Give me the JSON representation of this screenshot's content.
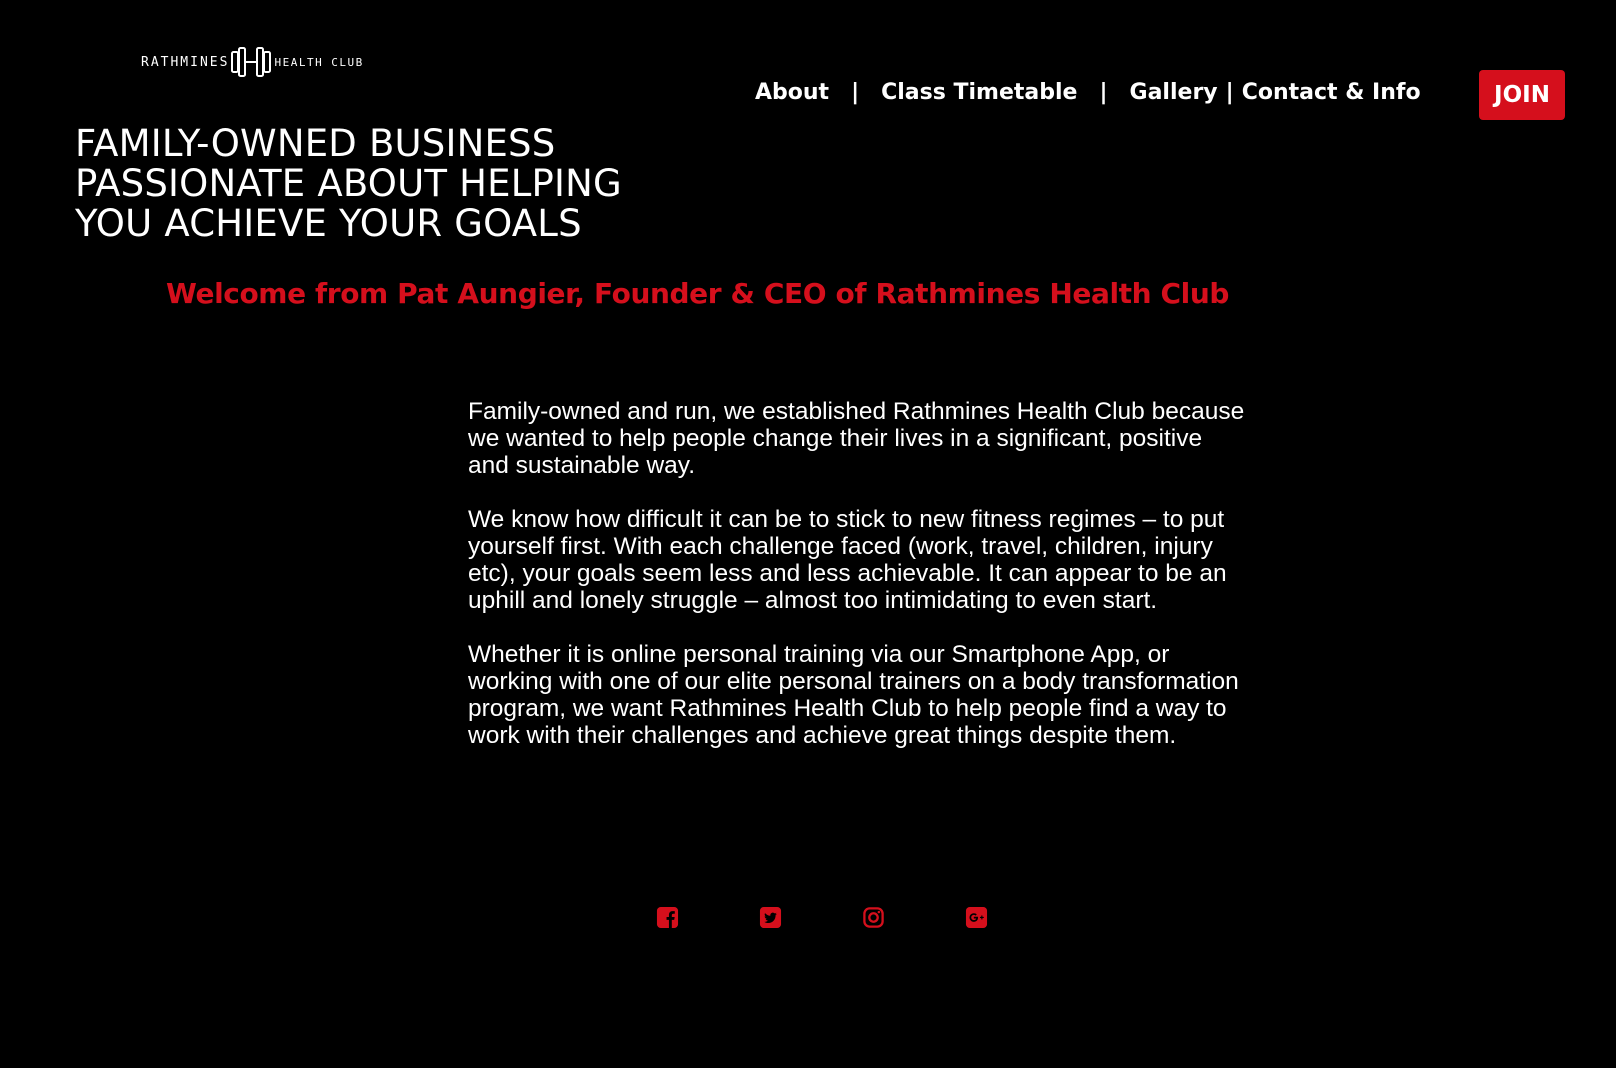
{
  "logo": {
    "left_text": "RATHMINES",
    "right_text": "HEALTH CLUB",
    "icon": "dumbbell-icon"
  },
  "nav": {
    "items": [
      {
        "label": "About"
      },
      {
        "label": "Class Timetable"
      },
      {
        "label": "Gallery"
      },
      {
        "label": "Contact & Info"
      }
    ],
    "separator": "|"
  },
  "join_button": "JOIN",
  "hero": {
    "lines": [
      "FAMILY-OWNED BUSINESS",
      "PASSIONATE ABOUT HELPING",
      "YOU ACHIEVE YOUR GOALS"
    ]
  },
  "welcome": "Welcome from Pat Aungier, Founder & CEO of Rathmines Health Club",
  "paragraphs": [
    "Family-owned and run, we established Rathmines Health Club because we wanted to help people change their lives in a significant, positive and sustainable way.",
    "We know how difficult it can be to stick to new fitness regimes – to put yourself first. With each challenge faced (work, travel, children, injury etc), your goals seem less and less achievable. It can appear to be an uphill and lonely struggle – almost too intimidating to even start.",
    "Whether it is online personal training via our Smartphone App, or working with one of our elite personal trainers on a body transformation program, we want Rathmines Health Club to help people find a way to work with their challenges and achieve great things despite them."
  ],
  "social": [
    "facebook-icon",
    "twitter-icon",
    "instagram-icon",
    "google-plus-icon"
  ],
  "colors": {
    "background": "#000000",
    "accent": "#d50f1c",
    "text": "#ffffff"
  }
}
